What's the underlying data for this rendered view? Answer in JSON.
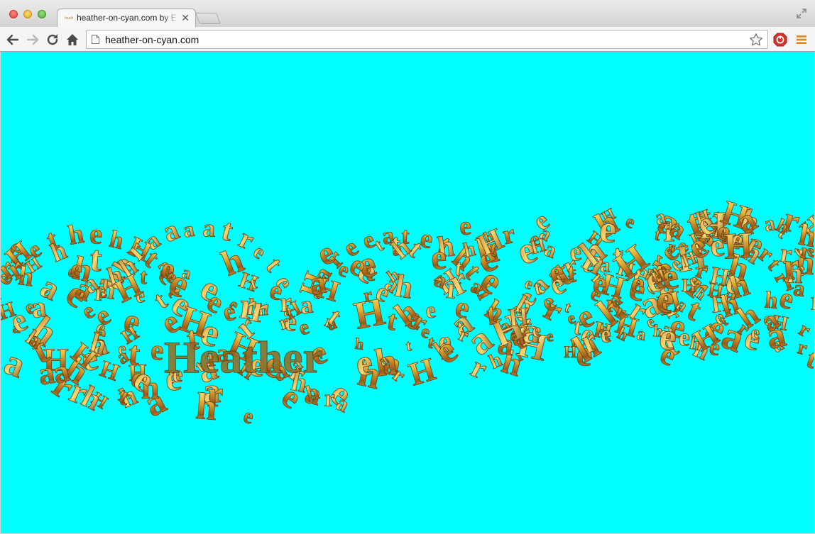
{
  "window": {
    "tab_title": "heather-on-cyan.com by E",
    "tab_favicon_text": "heath",
    "tab_close_glyph": "✕"
  },
  "toolbar": {
    "url": "heather-on-cyan.com",
    "back_icon": "back-arrow-icon",
    "forward_icon": "forward-arrow-icon",
    "reload_icon": "reload-icon",
    "home_icon": "home-icon",
    "bookmark_icon": "star-icon",
    "extension_icon": "adblock-icon",
    "menu_icon": "hamburger-menu-icon"
  },
  "page": {
    "background_color": "#00ffff",
    "glyph_color": "#c9932f",
    "scene_word": "Heather"
  },
  "colors": {
    "accent_menu": "#e0871a",
    "extension_red": "#d7322b"
  }
}
